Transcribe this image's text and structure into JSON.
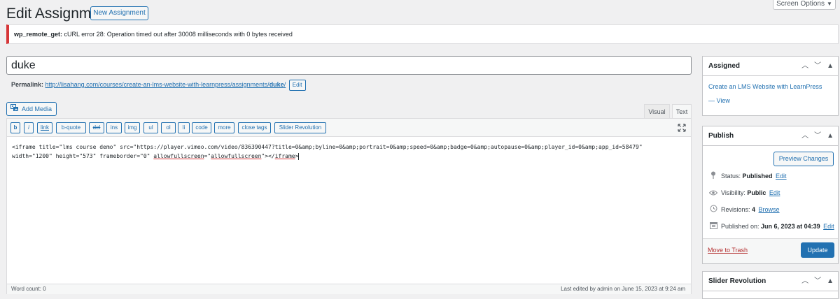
{
  "header": {
    "title": "Edit Assignment",
    "new_button": "New Assignment",
    "screen_options": "Screen Options"
  },
  "notice": {
    "code": "wp_remote_get:",
    "message": " cURL error 28: Operation timed out after 30008 milliseconds with 0 bytes received"
  },
  "post": {
    "title": "duke",
    "permalink_label": "Permalink:",
    "permalink_base": "http://lisahang.com/courses/create-an-lms-website-with-learnpress/assignments/",
    "permalink_slug": "duke",
    "permalink_trailing": "/",
    "permalink_edit": "Edit"
  },
  "editor": {
    "add_media": "Add Media",
    "tab_visual": "Visual",
    "tab_text": "Text",
    "toolbar": {
      "b": "b",
      "i": "i",
      "link": "link",
      "bquote": "b-quote",
      "del": "del",
      "ins": "ins",
      "img": "img",
      "ul": "ul",
      "ol": "ol",
      "li": "li",
      "code": "code",
      "more": "more",
      "close_tags": "close tags",
      "slider_revolution": "Slider Revolution"
    },
    "content_part1": "<iframe title=\"lms course demo\" src=\"https://player.vimeo.com/video/836390447?title=0&amp;byline=0&amp;portrait=0&amp;speed=0&amp;badge=0&amp;autopause=0&amp;player_id=0&amp;app_id=58479\"\nwidth=\"1200\" height=\"573\" frameborder=\"0\" ",
    "content_allowfs1": "allowfullscreen",
    "content_eq": "=\"",
    "content_allowfs2": "allowfullscreen",
    "content_close": "\"></",
    "content_iframe": "iframe",
    "content_end": ">",
    "word_count": "Word count: 0",
    "last_edited": "Last edited by admin on June 15, 2023 at 9:24 am"
  },
  "assigned_box": {
    "title": "Assigned",
    "course_link": "Create an LMS Website with LearnPress",
    "view_link": "— View"
  },
  "publish_box": {
    "title": "Publish",
    "preview": "Preview Changes",
    "status_label": "Status: ",
    "status_value": "Published",
    "visibility_label": "Visibility: ",
    "visibility_value": "Public",
    "revisions_label": "Revisions: ",
    "revisions_value": "4",
    "browse": "Browse",
    "published_label": "Published on: ",
    "published_value": "Jun 6, 2023 at 04:39",
    "edit": "Edit",
    "trash": "Move to Trash",
    "update": "Update"
  },
  "slider_box": {
    "title": "Slider Revolution"
  },
  "colors": {
    "primary": "#2271b1",
    "error": "#d63638",
    "background": "#f0f0f1"
  }
}
